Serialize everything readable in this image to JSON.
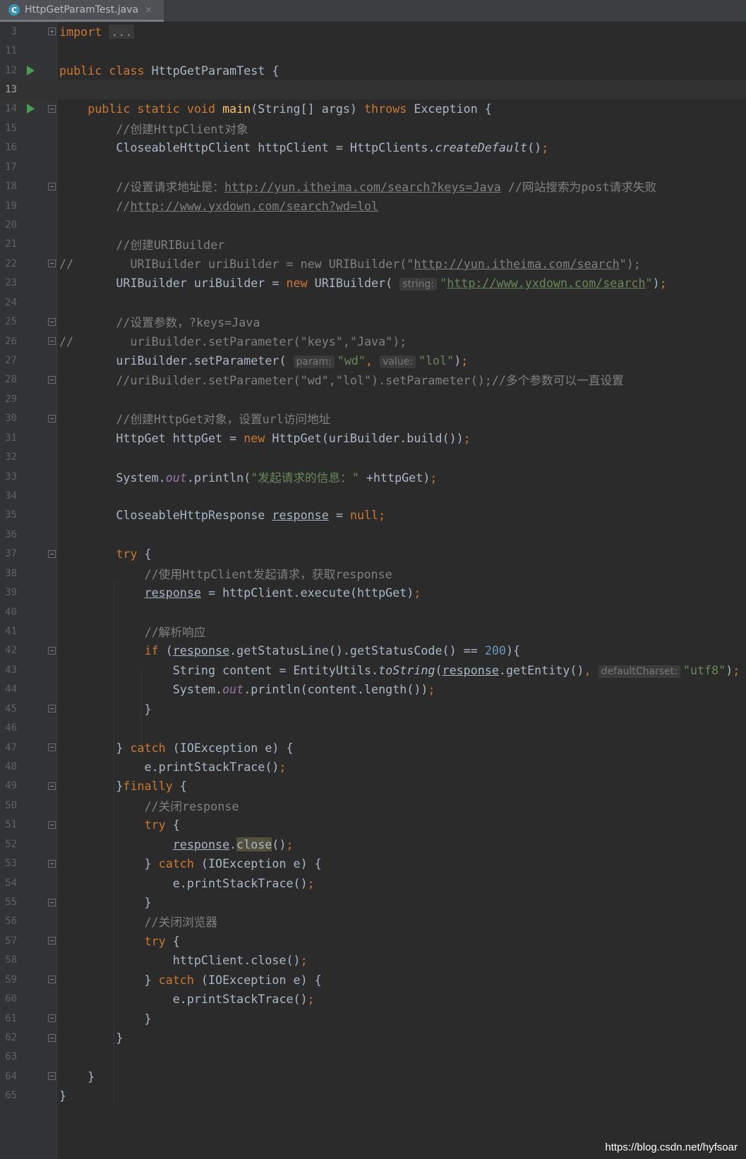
{
  "tab": {
    "label": "HttpGetParamTest.java",
    "close": "×",
    "icon": "C"
  },
  "lines": [
    {
      "n": "3",
      "fold": "plus",
      "html": "<span class=\"kw\">import</span> <span class=\"fold-box\">...</span>"
    },
    {
      "n": "11",
      "html": ""
    },
    {
      "n": "12",
      "run": true,
      "html": "<span class=\"kw\">public class</span> HttpGetParamTest {"
    },
    {
      "n": "13",
      "current": true,
      "html": ""
    },
    {
      "n": "14",
      "run": true,
      "fold": "minus",
      "html": "    <span class=\"kw\">public static void</span> <span class=\"fn\">main</span>(String[] args) <span class=\"kw\">throws</span> Exception {"
    },
    {
      "n": "15",
      "html": "        <span class=\"cm\">//创建HttpClient对象</span>"
    },
    {
      "n": "16",
      "html": "        CloseableHttpClient httpClient = HttpClients.<span class=\"it\">createDefault</span>()<span class=\"kw\">;</span>"
    },
    {
      "n": "17",
      "html": ""
    },
    {
      "n": "18",
      "fold": "minus",
      "html": "        <span class=\"cm\">//设置请求地址是：<span class=\"url\">http://yun.itheima.com/search?keys=Java</span> //网站搜索为post请求失败</span>"
    },
    {
      "n": "19",
      "html": "        <span class=\"cm\">//<span class=\"url\">http://www.yxdown.com/search?wd=lol</span></span>"
    },
    {
      "n": "20",
      "html": ""
    },
    {
      "n": "21",
      "html": "        <span class=\"cm\">//创建URIBuilder</span>"
    },
    {
      "n": "22",
      "fold": "minus",
      "html": "<span class=\"cm\">//        URIBuilder uriBuilder = new URIBuilder(\"<span class=\"url\">http://yun.itheima.com/search</span>\");</span>"
    },
    {
      "n": "23",
      "html": "        URIBuilder uriBuilder = <span class=\"kw\">new</span> URIBuilder( <span class=\"hint\">string:</span><span class=\"st\">\"<span class=\"url\">http://www.yxdown.com/search</span>\"</span>)<span class=\"kw\">;</span>"
    },
    {
      "n": "24",
      "html": ""
    },
    {
      "n": "25",
      "fold": "minus",
      "html": "        <span class=\"cm\">//设置参数，?keys=Java</span>"
    },
    {
      "n": "26",
      "fold": "minus",
      "html": "<span class=\"cm\">//        uriBuilder.setParameter(\"keys\",\"Java\");</span>"
    },
    {
      "n": "27",
      "html": "        uriBuilder.setParameter( <span class=\"hint\">param:</span><span class=\"st\">\"wd\"</span><span class=\"kw\">,</span> <span class=\"hint\">value:</span><span class=\"st\">\"lol\"</span>)<span class=\"kw\">;</span>"
    },
    {
      "n": "28",
      "fold": "minus",
      "html": "        <span class=\"cm\">//uriBuilder.setParameter(\"wd\",\"lol\").setParameter();//多个参数可以一直设置</span>"
    },
    {
      "n": "29",
      "html": ""
    },
    {
      "n": "30",
      "fold": "minus",
      "html": "        <span class=\"cm\">//创建HttpGet对象，设置url访问地址</span>"
    },
    {
      "n": "31",
      "html": "        HttpGet httpGet = <span class=\"kw\">new</span> HttpGet(uriBuilder.build())<span class=\"kw\">;</span>"
    },
    {
      "n": "32",
      "html": ""
    },
    {
      "n": "33",
      "html": "        System.<span class=\"sf\">out</span>.println(<span class=\"st\">\"发起请求的信息：\"</span> +httpGet)<span class=\"kw\">;</span>"
    },
    {
      "n": "34",
      "html": ""
    },
    {
      "n": "35",
      "html": "        CloseableHttpResponse <span class=\"ul\">response</span> = <span class=\"kw\">null;</span>"
    },
    {
      "n": "36",
      "html": ""
    },
    {
      "n": "37",
      "fold": "minus",
      "html": "        <span class=\"kw\">try</span> {"
    },
    {
      "n": "38",
      "html": "            <span class=\"cm\">//使用HttpClient发起请求，获取response</span>"
    },
    {
      "n": "39",
      "html": "            <span class=\"ul\">response</span> = httpClient.execute(httpGet)<span class=\"kw\">;</span>"
    },
    {
      "n": "40",
      "html": ""
    },
    {
      "n": "41",
      "html": "            <span class=\"cm\">//解析响应</span>"
    },
    {
      "n": "42",
      "fold": "minus",
      "html": "            <span class=\"kw\">if</span> (<span class=\"ul\">response</span>.getStatusLine().getStatusCode() == <span class=\"nm\">200</span>){"
    },
    {
      "n": "43",
      "html": "                String content = EntityUtils.<span class=\"it\">toString</span>(<span class=\"ul\">response</span>.getEntity()<span class=\"kw\">,</span> <span class=\"hint\">defaultCharset:</span><span class=\"st\">\"utf8\"</span>)<span class=\"kw\">;</span>"
    },
    {
      "n": "44",
      "html": "                System.<span class=\"sf\">out</span>.println(content.length())<span class=\"kw\">;</span>"
    },
    {
      "n": "45",
      "fold": "minus",
      "html": "            }"
    },
    {
      "n": "46",
      "html": ""
    },
    {
      "n": "47",
      "fold": "minus",
      "html": "        } <span class=\"kw\">catch</span> (IOException e) {"
    },
    {
      "n": "48",
      "html": "            e.printStackTrace()<span class=\"kw\">;</span>"
    },
    {
      "n": "49",
      "fold": "minus",
      "html": "        }<span class=\"kw\">finally</span> {"
    },
    {
      "n": "50",
      "html": "            <span class=\"cm\">//关闭response</span>"
    },
    {
      "n": "51",
      "fold": "minus",
      "html": "            <span class=\"kw\">try</span> {"
    },
    {
      "n": "52",
      "html": "                <span class=\"ul\">response</span>.<span class=\"hl\">close</span>()<span class=\"kw\">;</span>"
    },
    {
      "n": "53",
      "fold": "minus",
      "html": "            } <span class=\"kw\">catch</span> (IOException e) {"
    },
    {
      "n": "54",
      "html": "                e.printStackTrace()<span class=\"kw\">;</span>"
    },
    {
      "n": "55",
      "fold": "minus",
      "html": "            }"
    },
    {
      "n": "56",
      "html": "            <span class=\"cm\">//关闭浏览器</span>"
    },
    {
      "n": "57",
      "fold": "minus",
      "html": "            <span class=\"kw\">try</span> {"
    },
    {
      "n": "58",
      "html": "                httpClient.close()<span class=\"kw\">;</span>"
    },
    {
      "n": "59",
      "fold": "minus",
      "html": "            } <span class=\"kw\">catch</span> (IOException e) {"
    },
    {
      "n": "60",
      "html": "                e.printStackTrace()<span class=\"kw\">;</span>"
    },
    {
      "n": "61",
      "fold": "minus",
      "html": "            }"
    },
    {
      "n": "62",
      "fold": "minus",
      "html": "        }"
    },
    {
      "n": "63",
      "html": ""
    },
    {
      "n": "64",
      "fold": "minus",
      "html": "    }"
    },
    {
      "n": "65",
      "html": "}"
    }
  ],
  "watermark": "https://blog.csdn.net/hyfsoar"
}
